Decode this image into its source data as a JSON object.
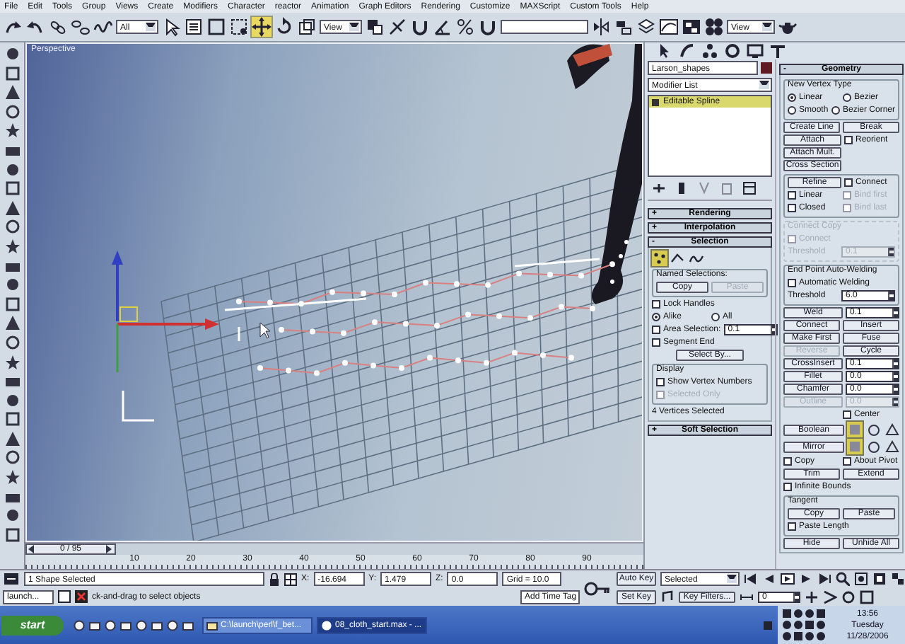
{
  "menu": [
    "File",
    "Edit",
    "Tools",
    "Group",
    "Views",
    "Create",
    "Modifiers",
    "Character",
    "reactor",
    "Animation",
    "Graph Editors",
    "Rendering",
    "Customize",
    "MAXScript",
    "Custom Tools",
    "Help"
  ],
  "toolbar": {
    "selection_filter": "All",
    "move_active": true,
    "reference_coordinate": "View",
    "render_preset": "View"
  },
  "viewport": {
    "label": "Perspective"
  },
  "command_panel": {
    "object_name": "Larson_shapes",
    "modifier_list": "Modifier List",
    "stack": [
      {
        "label": "Editable Spline",
        "selected": true
      }
    ],
    "left_rollouts": [
      {
        "sign": "+",
        "title": "Rendering"
      },
      {
        "sign": "+",
        "title": "Interpolation"
      },
      {
        "sign": "-",
        "title": "Selection",
        "rows": [
          {
            "items": [
              {
                "kind": "level",
                "selected": true
              },
              {
                "kind": "level",
                "selected": false
              },
              {
                "kind": "level",
                "selected": false
              }
            ]
          },
          {
            "kind": "group",
            "title": "Named Selections:",
            "disabled": false,
            "rows": [
              {
                "items": [
                  {
                    "kind": "button",
                    "label": "Copy",
                    "disabled": false
                  },
                  {
                    "kind": "button",
                    "label": "Paste",
                    "disabled": true
                  }
                ]
              }
            ]
          },
          {
            "items": [
              {
                "kind": "check",
                "label": "Lock Handles",
                "checked": false,
                "disabled": false
              }
            ]
          },
          {
            "items": [
              {
                "kind": "radio",
                "label": "Alike",
                "selected": true
              },
              {
                "kind": "radio",
                "label": "All",
                "selected": false
              }
            ]
          },
          {
            "items": [
              {
                "kind": "check",
                "label": "Area Selection:",
                "checked": false,
                "disabled": false
              },
              {
                "kind": "spinner",
                "value": "0.1",
                "disabled": false
              }
            ]
          },
          {
            "items": [
              {
                "kind": "check",
                "label": "Segment End",
                "checked": false,
                "disabled": false
              }
            ]
          },
          {
            "items": [
              {
                "kind": "button",
                "label": "Select By...",
                "disabled": false
              }
            ]
          },
          {
            "kind": "group",
            "title": "Display",
            "disabled": false,
            "rows": [
              {
                "items": [
                  {
                    "kind": "check",
                    "label": "Show Vertex Numbers",
                    "checked": false,
                    "disabled": false
                  }
                ]
              },
              {
                "items": [
                  {
                    "kind": "check",
                    "label": "Selected Only",
                    "checked": false,
                    "disabled": true
                  }
                ]
              }
            ]
          },
          {
            "items": [
              {
                "kind": "text",
                "label": "4 Vertices Selected",
                "disabled": false
              }
            ]
          }
        ]
      },
      {
        "sign": "+",
        "title": "Soft Selection"
      }
    ],
    "right_rollouts": [
      {
        "sign": "-",
        "title": "Geometry",
        "rows": [
          {
            "kind": "group",
            "title": "New Vertex Type",
            "disabled": false,
            "rows": [
              {
                "items": [
                  {
                    "kind": "radio",
                    "label": "Linear",
                    "selected": true
                  },
                  {
                    "kind": "radio",
                    "label": "Bezier",
                    "selected": false
                  }
                ]
              },
              {
                "items": [
                  {
                    "kind": "radio",
                    "label": "Smooth",
                    "selected": false
                  },
                  {
                    "kind": "radio",
                    "label": "Bezier Corner",
                    "selected": false
                  }
                ]
              }
            ]
          },
          {
            "items": [
              {
                "kind": "button",
                "label": "Create Line",
                "disabled": false
              },
              {
                "kind": "button",
                "label": "Break",
                "disabled": false
              }
            ]
          },
          {
            "items": [
              {
                "kind": "button",
                "label": "Attach",
                "disabled": false
              },
              {
                "kind": "check",
                "label": "Reorient",
                "checked": false,
                "disabled": false
              }
            ]
          },
          {
            "items": [
              {
                "kind": "button",
                "label": "Attach Mult.",
                "disabled": false
              },
              {
                "kind": "gap"
              }
            ]
          },
          {
            "items": [
              {
                "kind": "button",
                "label": "Cross Section",
                "disabled": false
              },
              {
                "kind": "gap"
              }
            ]
          },
          {
            "kind": "group",
            "rows": [
              {
                "items": [
                  {
                    "kind": "button",
                    "label": "Refine",
                    "disabled": false
                  },
                  {
                    "kind": "check",
                    "label": "Connect",
                    "checked": false,
                    "disabled": false
                  }
                ]
              },
              {
                "items": [
                  {
                    "kind": "check",
                    "label": "Linear",
                    "checked": false,
                    "disabled": false
                  },
                  {
                    "kind": "check",
                    "label": "Bind first",
                    "checked": false,
                    "disabled": true
                  }
                ]
              },
              {
                "items": [
                  {
                    "kind": "check",
                    "label": "Closed",
                    "checked": false,
                    "disabled": false
                  },
                  {
                    "kind": "check",
                    "label": "Bind last",
                    "checked": false,
                    "disabled": true
                  }
                ]
              }
            ]
          },
          {
            "kind": "group",
            "title": "Connect Copy",
            "disabled": true,
            "rows": [
              {
                "items": [
                  {
                    "kind": "check",
                    "label": "Connect",
                    "checked": false,
                    "disabled": true
                  }
                ]
              },
              {
                "items": [
                  {
                    "kind": "text",
                    "label": "Threshold",
                    "disabled": true
                  },
                  {
                    "kind": "spinner",
                    "value": "0.1",
                    "disabled": true
                  }
                ]
              }
            ]
          },
          {
            "kind": "group",
            "title": "End Point Auto-Welding",
            "disabled": false,
            "rows": [
              {
                "items": [
                  {
                    "kind": "check",
                    "label": "Automatic Welding",
                    "checked": false,
                    "disabled": false
                  }
                ]
              },
              {
                "items": [
                  {
                    "kind": "text",
                    "label": "Threshold",
                    "disabled": false
                  },
                  {
                    "kind": "spinner",
                    "value": "6.0",
                    "disabled": false
                  }
                ]
              }
            ]
          },
          {
            "items": [
              {
                "kind": "button",
                "label": "Weld",
                "disabled": false
              },
              {
                "kind": "spinner",
                "value": "0.1",
                "disabled": false
              }
            ]
          },
          {
            "items": [
              {
                "kind": "button",
                "label": "Connect",
                "disabled": false
              },
              {
                "kind": "button",
                "label": "Insert",
                "disabled": false
              }
            ]
          },
          {
            "items": [
              {
                "kind": "button",
                "label": "Make First",
                "disabled": false
              },
              {
                "kind": "button",
                "label": "Fuse",
                "disabled": false
              }
            ]
          },
          {
            "items": [
              {
                "kind": "button",
                "label": "Reverse",
                "disabled": true
              },
              {
                "kind": "button",
                "label": "Cycle",
                "disabled": false
              }
            ]
          },
          {
            "items": [
              {
                "kind": "button",
                "label": "CrossInsert",
                "disabled": false
              },
              {
                "kind": "spinner",
                "value": "0.1",
                "disabled": false
              }
            ]
          },
          {
            "items": [
              {
                "kind": "button",
                "label": "Fillet",
                "disabled": false
              },
              {
                "kind": "spinner",
                "value": "0.0",
                "disabled": false
              }
            ]
          },
          {
            "items": [
              {
                "kind": "button",
                "label": "Chamfer",
                "disabled": false
              },
              {
                "kind": "spinner",
                "value": "0.0",
                "disabled": false
              }
            ]
          },
          {
            "items": [
              {
                "kind": "button",
                "label": "Outline",
                "disabled": true
              },
              {
                "kind": "spinner",
                "value": "0.0",
                "disabled": true
              }
            ]
          },
          {
            "items": [
              {
                "kind": "gap"
              },
              {
                "kind": "check",
                "label": "Center",
                "checked": false,
                "disabled": false
              }
            ]
          },
          {
            "items": [
              {
                "kind": "button",
                "label": "Boolean",
                "disabled": false
              },
              {
                "kind": "tool",
                "selected": true
              },
              {
                "kind": "tool",
                "selected": false
              },
              {
                "kind": "tool",
                "selected": false
              }
            ]
          },
          {
            "items": [
              {
                "kind": "button",
                "label": "Mirror",
                "disabled": false
              },
              {
                "kind": "tool",
                "selected": true
              },
              {
                "kind": "tool",
                "selected": false
              },
              {
                "kind": "tool",
                "selected": false
              }
            ]
          },
          {
            "items": [
              {
                "kind": "check",
                "label": "Copy",
                "checked": false,
                "disabled": false
              },
              {
                "kind": "check",
                "label": "About Pivot",
                "checked": false,
                "disabled": false
              }
            ]
          },
          {
            "items": [
              {
                "kind": "button",
                "label": "Trim",
                "disabled": false
              },
              {
                "kind": "button",
                "label": "Extend",
                "disabled": false
              }
            ]
          },
          {
            "items": [
              {
                "kind": "check",
                "label": "Infinite Bounds",
                "checked": false,
                "disabled": false
              }
            ]
          },
          {
            "kind": "group",
            "title": "Tangent",
            "disabled": false,
            "rows": [
              {
                "items": [
                  {
                    "kind": "button",
                    "label": "Copy",
                    "disabled": false
                  },
                  {
                    "kind": "button",
                    "label": "Paste",
                    "disabled": false
                  }
                ]
              },
              {
                "items": [
                  {
                    "kind": "check",
                    "label": "Paste Length",
                    "checked": false,
                    "disabled": false
                  }
                ]
              }
            ]
          },
          {
            "items": [
              {
                "kind": "button",
                "label": "Hide",
                "disabled": false
              },
              {
                "kind": "button",
                "label": "Unhide All",
                "disabled": false
              }
            ]
          }
        ]
      }
    ]
  },
  "time_slider": {
    "label": "0 / 95",
    "level": 0
  },
  "track": {
    "ticks": [
      "10",
      "20",
      "30",
      "40",
      "50",
      "60",
      "70",
      "80",
      "90"
    ]
  },
  "status": {
    "listener": "launch...",
    "selection": "1 Shape Selected",
    "coords": [
      {
        "axis": "X:",
        "value": "-16.694"
      },
      {
        "axis": "Y:",
        "value": "1.479"
      },
      {
        "axis": "Z:",
        "value": "0.0"
      }
    ],
    "grid": "Grid = 10.0",
    "prompt": "ck-and-drag to select objects",
    "add_time_tag": "Add Time Tag"
  },
  "animation": {
    "auto_key": "Auto Key",
    "key_mode": "Selected",
    "set_key": "Set Key",
    "key_filters": "Key Filters...",
    "frame": "0"
  },
  "taskbar": {
    "start": "start",
    "tasks": [
      {
        "label": "C:\\launch\\perl\\f_bet...",
        "selected": false
      },
      {
        "label": "08_cloth_start.max - ...",
        "selected": true
      }
    ],
    "clock": {
      "time": "13:56",
      "day": "Tuesday",
      "date": "11/28/2006"
    }
  }
}
